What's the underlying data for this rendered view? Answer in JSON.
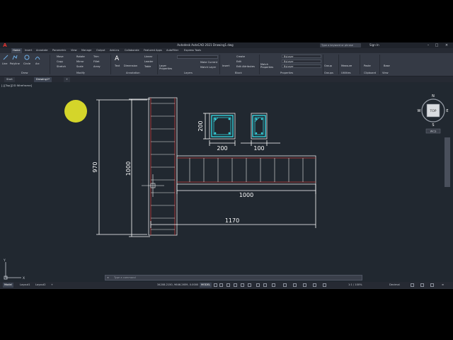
{
  "title_bar": {
    "app_title": "Autodesk AutoCAD 2021   Drawing1.dwg",
    "search_placeholder": "Type a keyword or phrase",
    "sign_in": "Sign In"
  },
  "ribbon_tabs": [
    "Home",
    "Insert",
    "Annotate",
    "Parametric",
    "View",
    "Manage",
    "Output",
    "Add-ins",
    "Collaborate",
    "Featured Apps",
    "AutoFilter",
    "Express Tools"
  ],
  "ribbon": {
    "draw": {
      "tools": [
        "Line",
        "Polyline",
        "Circle",
        "Arc"
      ],
      "label": "Draw"
    },
    "modify": {
      "tools": [
        "Move",
        "Rotate",
        "Trim",
        "Copy",
        "Mirror",
        "Fillet",
        "Stretch",
        "Scale",
        "Array"
      ],
      "label": "Modify"
    },
    "annotation": {
      "tools": [
        "Text",
        "Dimension",
        "Linear",
        "Leader",
        "Table"
      ],
      "label": "Annotation"
    },
    "layers": {
      "tools": [
        "Layer Properties",
        "Make Current",
        "Match Layer"
      ],
      "label": "Layers"
    },
    "block": {
      "tools": [
        "Insert",
        "Create",
        "Edit",
        "Edit Attributes"
      ],
      "label": "Block"
    },
    "properties": {
      "tools": [
        "Match Properties"
      ],
      "combos": [
        "ByLayer",
        "ByLayer",
        "ByLayer"
      ],
      "label": "Properties"
    },
    "groups": {
      "tools": [
        "Group"
      ],
      "label": "Groups"
    },
    "utilities": {
      "tools": [
        "Measure"
      ],
      "label": "Utilities"
    },
    "clipboard": {
      "tools": [
        "Paste"
      ],
      "label": "Clipboard"
    },
    "view": {
      "tools": [
        "Base"
      ],
      "label": "View"
    }
  },
  "doc_tabs": [
    "Start",
    "Drawing1*"
  ],
  "viewport_label": "[-][Top][2D Wireframe]",
  "viewcube": {
    "top": "TOP",
    "n": "N",
    "s": "S",
    "e": "E",
    "w": "W",
    "wcs": "WCS"
  },
  "ucs": {
    "x": "X",
    "y": "Y"
  },
  "drawing_dims": {
    "dim_970": "970",
    "dim_1000_vertical": "1000",
    "dim_200_h": "200",
    "dim_200_w": "200",
    "dim_100": "100",
    "dim_1000_horizontal": "1000",
    "dim_1170": "1170"
  },
  "command_line": {
    "close": "×",
    "placeholder": "Type a command"
  },
  "status": {
    "tabs": [
      "Model",
      "Layout1",
      "Layout2"
    ],
    "coords": "34208.2150, 9646.2659, 0.0000",
    "mode": "MODEL",
    "scale": "1:1 / 100%",
    "units": "Decimal"
  },
  "colors": {
    "canvas": "#212830",
    "dim_text": "#ffffff",
    "object_line": "#c83c3c",
    "column_line": "#e8e8e8",
    "highlight": "#e8e82a",
    "section_cyan": "#35d1dc"
  }
}
